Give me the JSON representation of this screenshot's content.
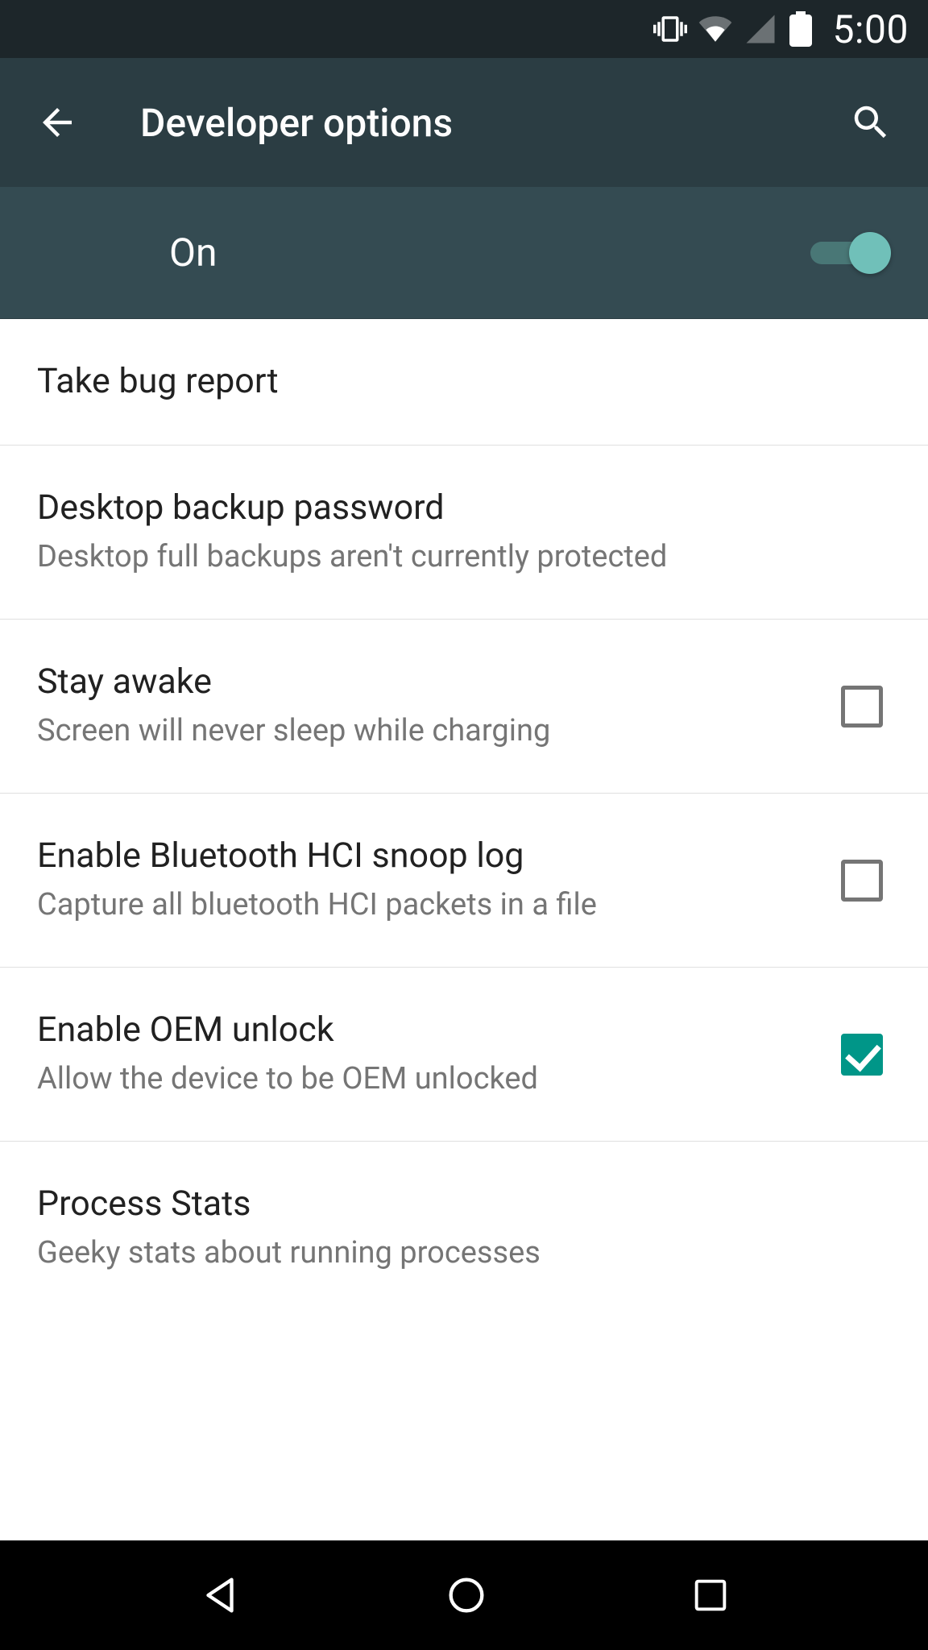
{
  "status": {
    "time": "5:00",
    "icons": [
      "vibrate-icon",
      "wifi-icon",
      "cell-icon",
      "battery-icon"
    ]
  },
  "header": {
    "title": "Developer options"
  },
  "master": {
    "label": "On",
    "enabled": true
  },
  "settings": [
    {
      "id": "take-bug-report",
      "title": "Take bug report"
    },
    {
      "id": "desktop-backup-password",
      "title": "Desktop backup password",
      "subtitle": "Desktop full backups aren't currently protected"
    },
    {
      "id": "stay-awake",
      "title": "Stay awake",
      "subtitle": "Screen will never sleep while charging",
      "checkbox": true,
      "checked": false
    },
    {
      "id": "bt-hci-snoop",
      "title": "Enable Bluetooth HCI snoop log",
      "subtitle": "Capture all bluetooth HCI packets in a file",
      "checkbox": true,
      "checked": false
    },
    {
      "id": "enable-oem-unlock",
      "title": "Enable OEM unlock",
      "subtitle": "Allow the device to be OEM unlocked",
      "checkbox": true,
      "checked": true
    },
    {
      "id": "process-stats",
      "title": "Process Stats",
      "subtitle": "Geeky stats about running processes"
    }
  ],
  "colors": {
    "statusBg": "#1d262a",
    "appBarBg": "#2b3d43",
    "masterBg": "#344b52",
    "accent": "#009688",
    "switchThumb": "#70c0b9"
  }
}
